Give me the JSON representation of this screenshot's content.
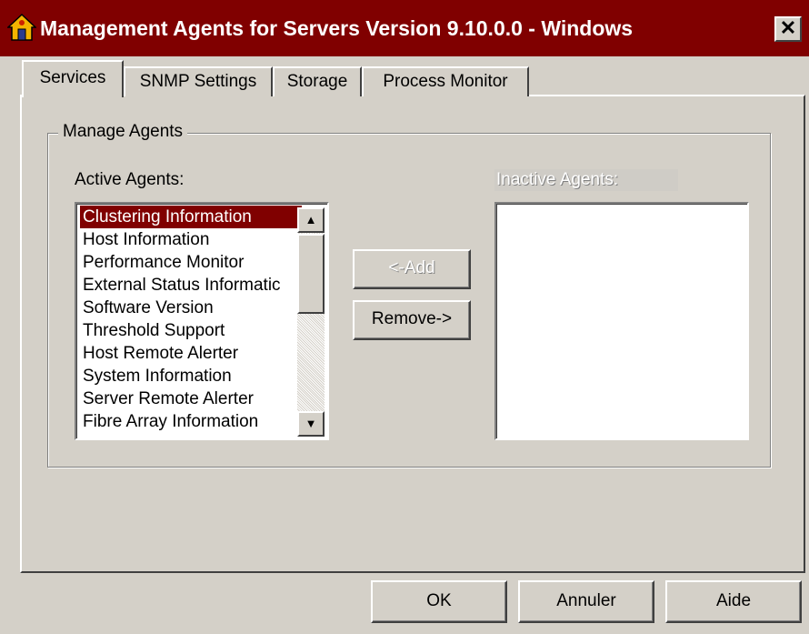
{
  "window": {
    "title": "Management Agents for Servers Version 9.10.0.0 - Windows",
    "close_glyph": "✕"
  },
  "tabs": [
    {
      "label": "Services",
      "active": true
    },
    {
      "label": "SNMP Settings",
      "active": false
    },
    {
      "label": "Storage",
      "active": false
    },
    {
      "label": "Process Monitor",
      "active": false
    }
  ],
  "group": {
    "label": "Manage Agents",
    "active_label": "Active Agents:",
    "inactive_label": "Inactive Agents:",
    "active_agents": [
      "Clustering Information",
      "Host Information",
      "Performance Monitor",
      "External Status Informatic",
      "Software Version",
      "Threshold Support",
      "Host Remote Alerter",
      "System Information",
      "Server Remote Alerter",
      "Fibre Array Information"
    ],
    "selected_agent": "Clustering Information",
    "inactive_agents": [],
    "add_button": "<-Add",
    "remove_button": "Remove->",
    "scroll_up_glyph": "▲",
    "scroll_down_glyph": "▼"
  },
  "footer": {
    "ok": "OK",
    "cancel": "Annuler",
    "help": "Aide"
  },
  "colors": {
    "titlebar": "#800000",
    "selection": "#800000",
    "face": "#d4d0c8"
  }
}
